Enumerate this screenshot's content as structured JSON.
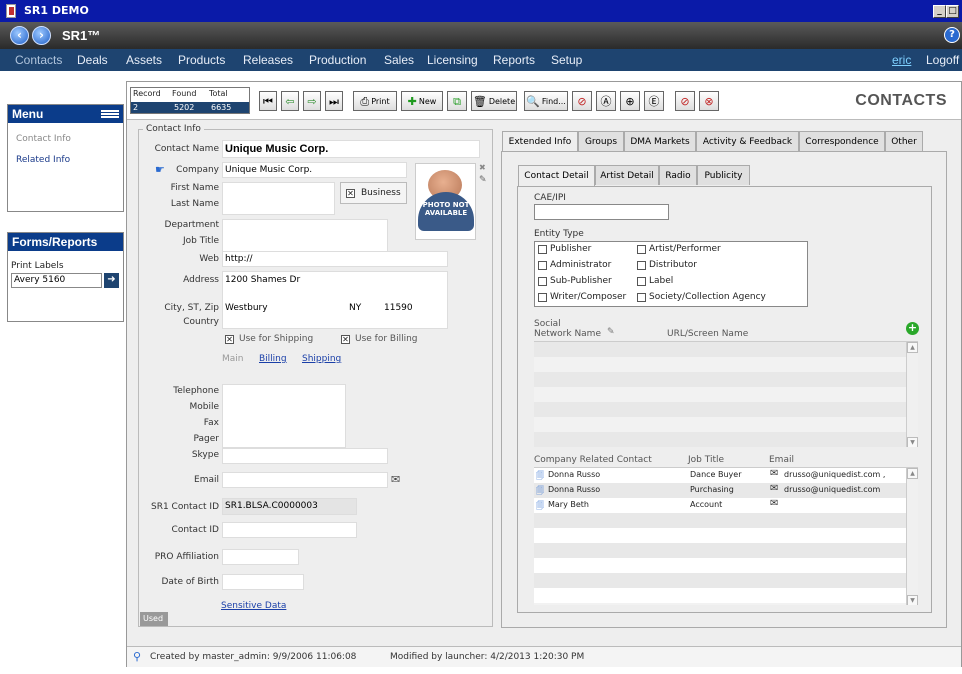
{
  "window": {
    "title": "SR1 DEMO"
  },
  "appbar": {
    "brand": "SR1™",
    "help": "?"
  },
  "menubar": {
    "items": [
      "Contacts",
      "Deals",
      "Assets",
      "Products",
      "Releases",
      "Production",
      "Sales",
      "Licensing",
      "Reports",
      "Setup"
    ],
    "user": "eric",
    "logoff": "Logoff"
  },
  "sidebar": {
    "menu_title": "Menu",
    "menu_items": [
      "Contact Info",
      "Related Info"
    ],
    "forms_title": "Forms/Reports",
    "print_labels_label": "Print Labels",
    "print_labels_value": "Avery 5160"
  },
  "toolbar": {
    "record_label": "Record",
    "found_label": "Found",
    "total_label": "Total",
    "record": "2",
    "found": "5202",
    "total": "6635",
    "print": "Print",
    "new": "New",
    "delete": "Delete",
    "find": "Find...",
    "page_title": "CONTACTS"
  },
  "contact": {
    "legend": "Contact Info",
    "contact_name_label": "Contact Name",
    "contact_name": "Unique Music Corp.",
    "company_label": "Company",
    "company": "Unique Music Corp.",
    "first_name_label": "First Name",
    "last_name_label": "Last Name",
    "business_label": "Business",
    "photo_text": "PHOTO NOT AVAILABLE",
    "department_label": "Department",
    "job_title_label": "Job Title",
    "web_label": "Web",
    "web": "http://",
    "address_label": "Address",
    "address": "1200 Shames Dr",
    "city_label": "City, ST, Zip",
    "city": "Westbury",
    "state": "NY",
    "zip": "11590",
    "country_label": "Country",
    "use_shipping": "Use for Shipping",
    "use_billing": "Use for Billing",
    "addr_tab_main": "Main",
    "addr_tab_billing": "Billing",
    "addr_tab_shipping": "Shipping",
    "telephone_label": "Telephone",
    "mobile_label": "Mobile",
    "fax_label": "Fax",
    "pager_label": "Pager",
    "skype_label": "Skype",
    "email_label": "Email",
    "sr1_id_label": "SR1 Contact ID",
    "sr1_id": "SR1.BLSA.C0000003",
    "contact_id_label": "Contact ID",
    "pro_label": "PRO Affiliation",
    "dob_label": "Date of Birth",
    "sensitive_link": "Sensitive Data",
    "used_badge": "Used"
  },
  "tabs": [
    "Extended Info",
    "Groups",
    "DMA Markets",
    "Activity & Feedback",
    "Correspondence",
    "Other"
  ],
  "subtabs": [
    "Contact Detail",
    "Artist Detail",
    "Radio",
    "Publicity"
  ],
  "detail": {
    "cae_label": "CAE/IPI",
    "entity_label": "Entity Type",
    "entity_left": [
      "Publisher",
      "Administrator",
      "Sub-Publisher",
      "Writer/Composer"
    ],
    "entity_right": [
      "Artist/Performer",
      "Distributor",
      "Label",
      "Society/Collection Agency"
    ],
    "social_label": "Social",
    "network_col": "Network Name",
    "url_col": "URL/Screen Name",
    "related_cols": [
      "Company Related Contact",
      "Job Title",
      "Email"
    ],
    "related_rows": [
      {
        "name": "Donna Russo",
        "title": "Dance Buyer",
        "email": "drusso@uniquedist.com ,"
      },
      {
        "name": "Donna Russo",
        "title": "Purchasing",
        "email": "drusso@uniquedist.com"
      },
      {
        "name": "Mary Beth",
        "title": "Account",
        "email": ""
      }
    ]
  },
  "status": {
    "created": "Created by master_admin: 9/9/2006 11:06:08",
    "modified": "Modified by launcher: 4/2/2013 1:20:30 PM"
  }
}
